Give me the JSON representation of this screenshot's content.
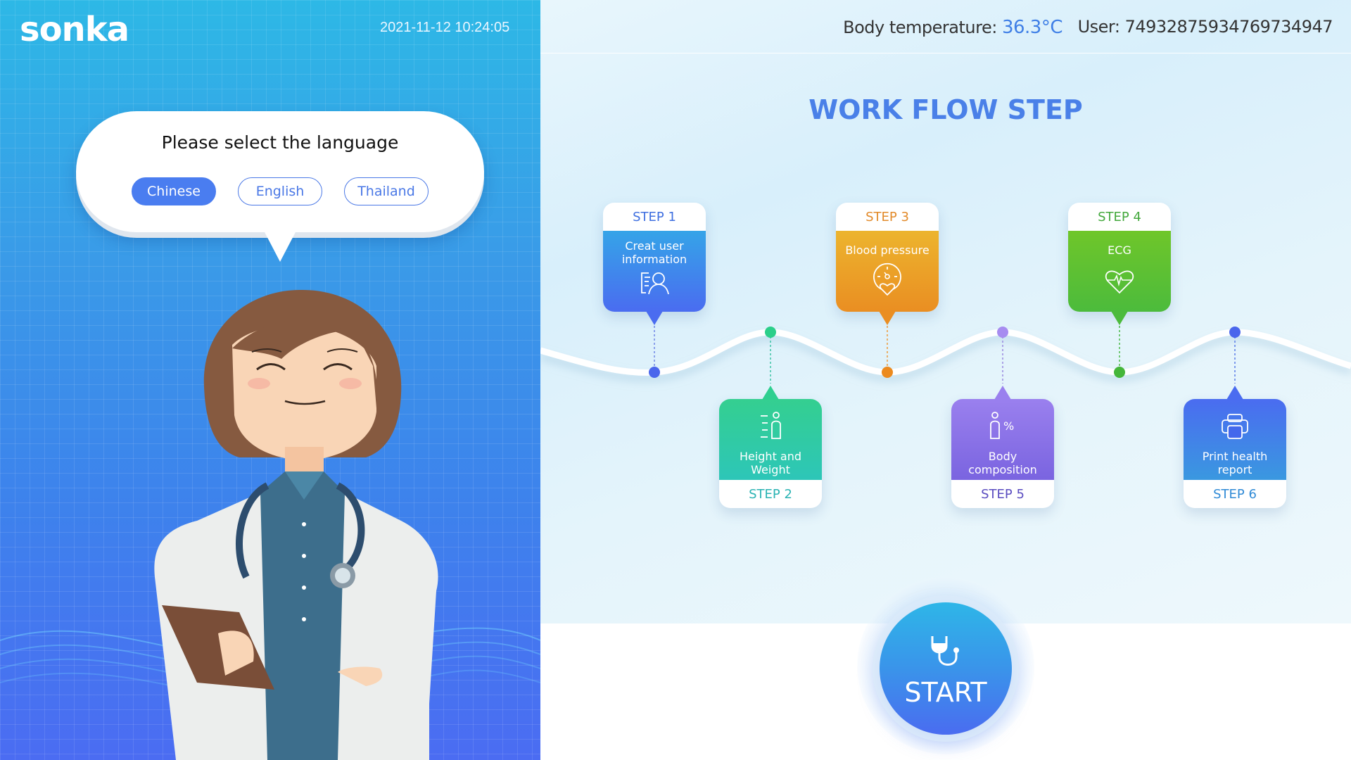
{
  "brand": {
    "logo": "sonka"
  },
  "header": {
    "datetime": "2021-11-12 10:24:05",
    "temperature_label": "Body temperature:",
    "temperature_value": "36.3°C",
    "user_label": "User:",
    "user_id": "749328759347697349​47"
  },
  "language": {
    "prompt": "Please select the language",
    "options": [
      {
        "label": "Chinese",
        "selected": true
      },
      {
        "label": "English",
        "selected": false
      },
      {
        "label": "Thailand",
        "selected": false
      }
    ]
  },
  "workflow": {
    "title": "WORK FLOW STEP",
    "steps": [
      {
        "step": "STEP 1",
        "name_line1": "Creat user",
        "name_line2": "information",
        "icon": "user-info-icon",
        "color": "#4a73f0",
        "color_top": "#35a4e8",
        "label_color": "#3f6fe0"
      },
      {
        "step": "STEP 2",
        "name_line1": "Height and",
        "name_line2": "Weight",
        "icon": "height-weight-icon",
        "color": "#2dc6b8",
        "color_top": "#34cf90",
        "label_color": "#2ab3b3"
      },
      {
        "step": "STEP 3",
        "name_line1": "Blood pressure",
        "name_line2": "",
        "icon": "blood-pressure-icon",
        "color": "#ea8e22",
        "color_top": "#ecb42e",
        "label_color": "#e28a2a"
      },
      {
        "step": "STEP 4",
        "name_line1": "ECG",
        "name_line2": "",
        "icon": "ecg-heart-icon",
        "color": "#4cbb3c",
        "color_top": "#6fc62a",
        "label_color": "#43a83c"
      },
      {
        "step": "STEP 5",
        "name_line1": "Body",
        "name_line2": "composition",
        "icon": "body-composition-icon",
        "color": "#7a64e0",
        "color_top": "#9a80ee",
        "label_color": "#5a4cc0"
      },
      {
        "step": "STEP 6",
        "name_line1": "Print health",
        "name_line2": "report",
        "icon": "printer-icon",
        "color": "#3a98e0",
        "color_top": "#4a6cf0",
        "label_color": "#2f8ad6"
      }
    ]
  },
  "start": {
    "label": "START"
  }
}
